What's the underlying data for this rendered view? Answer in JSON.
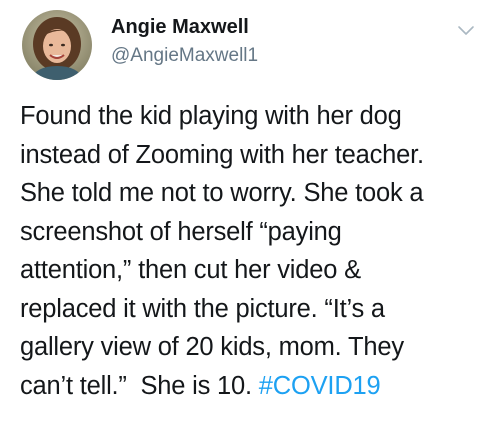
{
  "tweet": {
    "author": {
      "name": "Angie Maxwell",
      "handle": "@AngieMaxwell1"
    },
    "text_lines": [
      "Found the kid playing with her dog",
      "instead of Zooming with her teacher.",
      "She told me not to worry. She took a",
      "screenshot of herself “paying",
      "attention,” then cut her video &",
      "replaced it with the picture. “It’s a",
      "gallery view of 20 kids, mom. They",
      "can’t tell.”  She is 10. "
    ],
    "hashtag": "#COVID19",
    "icons": {
      "menu": "chevron-down-icon",
      "avatar": "avatar"
    },
    "colors": {
      "text": "#14171a",
      "secondary": "#657786",
      "link": "#1da1f2"
    }
  }
}
